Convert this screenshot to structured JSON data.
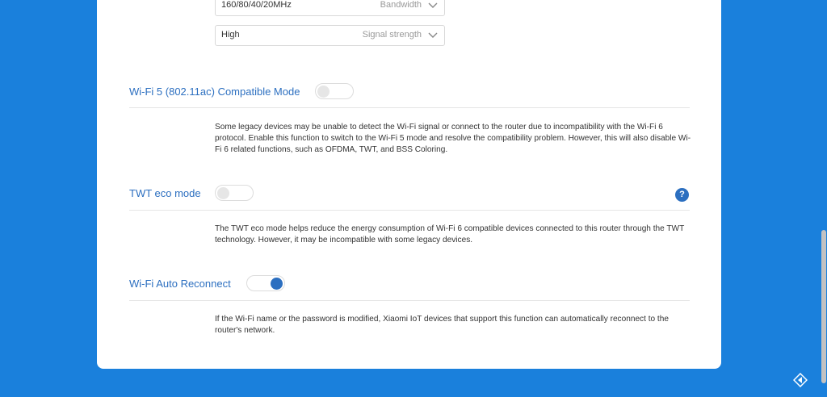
{
  "bandwidth_select": {
    "value": "160/80/40/20MHz",
    "label": "Bandwidth"
  },
  "signal_select": {
    "value": "High",
    "label": "Signal strength"
  },
  "wifi5": {
    "title": "Wi-Fi 5 (802.11ac) Compatible Mode",
    "enabled": false,
    "description": "Some legacy devices may be unable to detect the Wi-Fi signal or connect to the router due to incompatibility with the Wi-Fi 6 protocol. Enable this function to switch to the Wi-Fi 5 mode and resolve the compatibility problem. However, this will also disable Wi-Fi 6 related functions, such as OFDMA, TWT, and BSS Coloring."
  },
  "twt": {
    "title": "TWT eco mode",
    "enabled": false,
    "help": "?",
    "description": "The TWT eco mode helps reduce the energy consumption of Wi-Fi 6 compatible devices connected to this router through the TWT technology. However, it may be incompatible with some legacy devices."
  },
  "auto_reconnect": {
    "title": "Wi-Fi Auto Reconnect",
    "enabled": true,
    "description": "If the Wi-Fi name or the password is modified, Xiaomi IoT devices that support this function can automatically reconnect to the router's network."
  },
  "colors": {
    "accent": "#2c6fc0",
    "background": "#1a80dc"
  },
  "icons": {
    "chevron": "chevron-down-icon",
    "corner": "feedback-icon"
  }
}
